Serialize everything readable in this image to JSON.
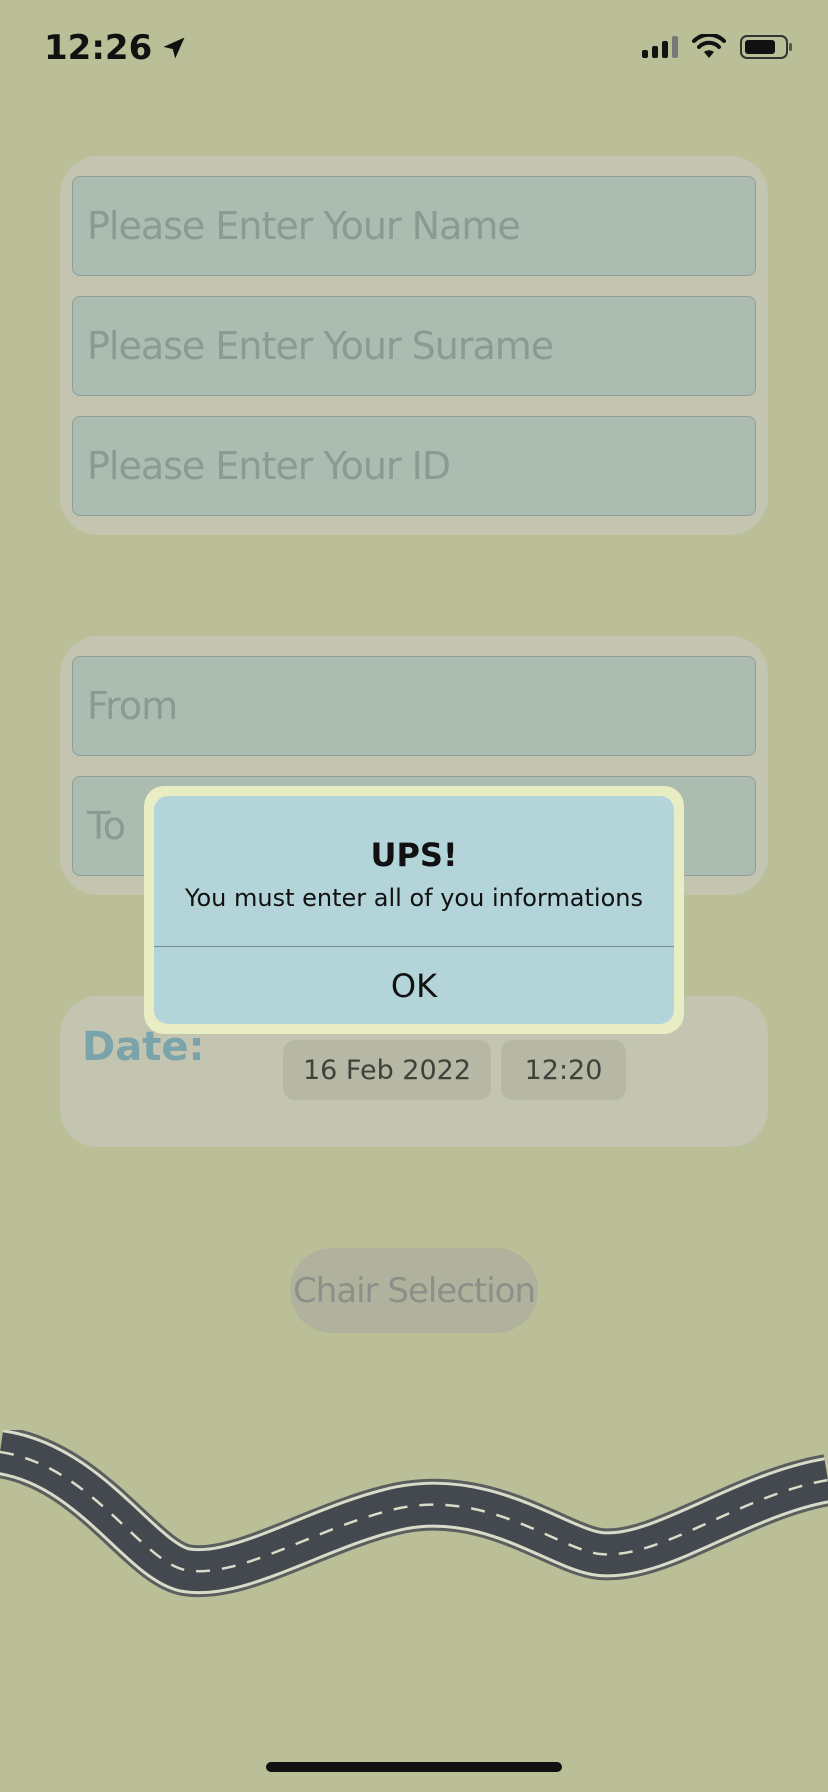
{
  "status_bar": {
    "time": "12:26",
    "icons": [
      "location-arrow-icon",
      "cellular-signal-icon",
      "wifi-icon",
      "battery-icon"
    ]
  },
  "personal_info": {
    "name_placeholder": "Please Enter Your Name",
    "surname_placeholder": "Please Enter Your Surame",
    "id_placeholder": "Please Enter Your ID"
  },
  "route": {
    "from_placeholder": "From",
    "to_placeholder": "To"
  },
  "date_section": {
    "label": "Date:",
    "date_value": "16 Feb 2022",
    "time_value": "12:20"
  },
  "chair_button": {
    "label": "Chair Selection"
  },
  "alert": {
    "title": "UPS!",
    "message": "You must enter all of you informations",
    "ok_label": "OK"
  },
  "colors": {
    "background": "#bbbf98",
    "card": "#c3c5b0",
    "field": "#acbcb0",
    "alert_border": "#e9edc4",
    "alert_fill": "#b3d5da",
    "date_label": "#7aa3aa",
    "road": "#444950"
  }
}
